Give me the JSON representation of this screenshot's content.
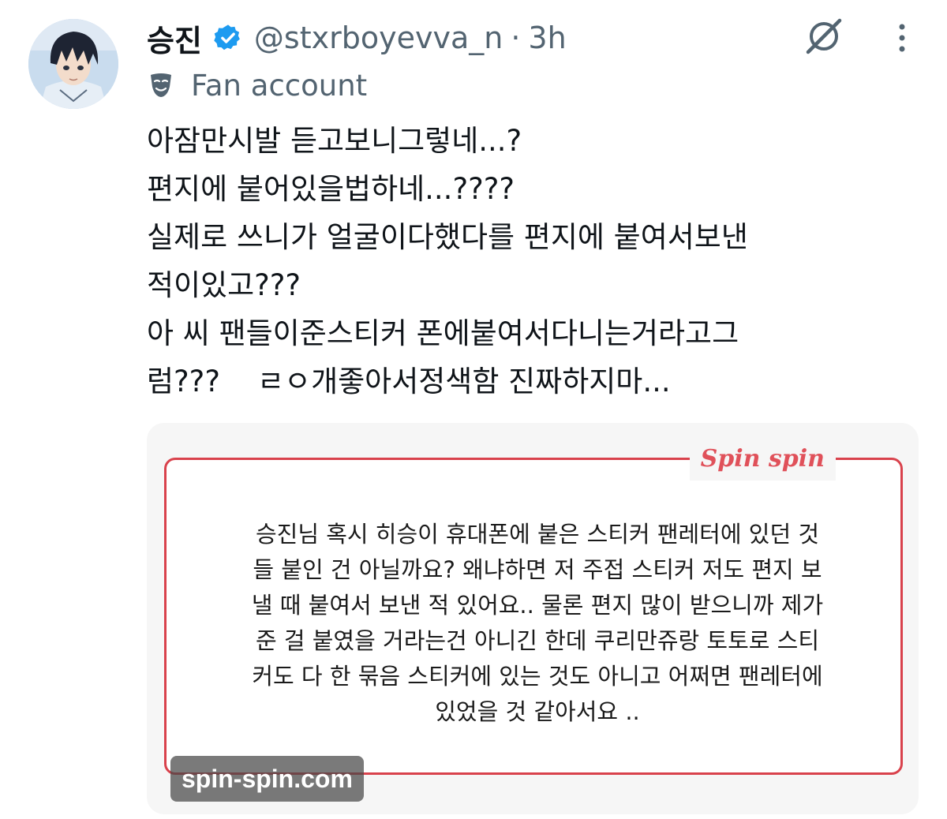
{
  "author": {
    "display_name": "승진",
    "verified_icon": "verified-badge-icon",
    "handle": "@stxrboyevva_n",
    "separator": "·",
    "time": "3h",
    "label": "Fan account",
    "label_icon": "theater-mask-icon",
    "avatar": "anime-character-avatar"
  },
  "actions": {
    "grok_icon": "grok-icon",
    "more_icon": "more-options-icon"
  },
  "tweet": {
    "lines": [
      "아잠만시발 듣고보니그렇네...?",
      "편지에 붙어있을법하네...????",
      "실제로 쓰니가 얼굴이다했다를 편지에 붙여서보낸",
      "적이있고???",
      "아 씨 팬들이준스티커 폰에붙여서다니는거라고그",
      "럼???    ㄹㅇ개좋아서정색함 진짜하지마..."
    ]
  },
  "media": {
    "brand": "Spin spin",
    "quote_lines": [
      "승진님 혹시 히승이 휴대폰에 붙은 스티커 팬레터에 있던 것",
      "들 붙인 건 아닐까요? 왜냐하면 저 주접 스티커 저도 편지 보",
      "낼 때 붙여서 보낸 적 있어요.. 물론 편지 많이 받으니까 제가",
      "준 걸 붙였을 거라는건 아니긴 한데 쿠리만쥬랑 토토로 스티",
      "커도 다 한 묶음 스티커에 있는 것도 아니고 어쩌면 팬레터에",
      "있었을 것 같아서요 .."
    ],
    "source": "spin-spin.com"
  },
  "colors": {
    "text_primary": "#0f1419",
    "text_secondary": "#536471",
    "verified_blue": "#1d9bf0",
    "frame_red": "#d9424c",
    "brand_red": "#e0515a"
  }
}
